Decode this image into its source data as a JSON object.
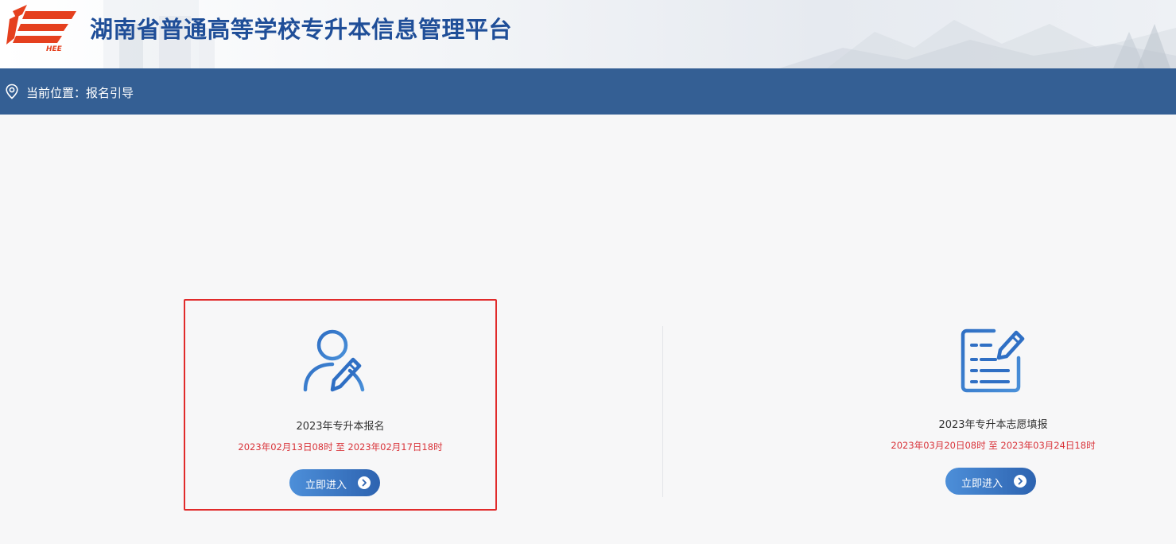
{
  "header": {
    "title": "湖南省普通高等学校专升本信息管理平台",
    "logo_text": "HEE"
  },
  "location": {
    "text": "当前位置：报名引导"
  },
  "cards": [
    {
      "title": "2023年专升本报名",
      "time": "2023年02月13日08时 至 2023年02月17日18时",
      "button_label": "立即进入",
      "icon": "user-edit-icon",
      "selected": true
    },
    {
      "title": "2023年专升本志愿填报",
      "time": "2023年03月20日08时 至 2023年03月24日18时",
      "button_label": "立即进入",
      "icon": "form-edit-icon",
      "selected": false
    }
  ],
  "colors": {
    "brand_blue": "#1f4e98",
    "bar_blue": "#345f94",
    "highlight_red": "#e12b2b",
    "time_red": "#d9343a",
    "logo_red": "#e5401e"
  }
}
